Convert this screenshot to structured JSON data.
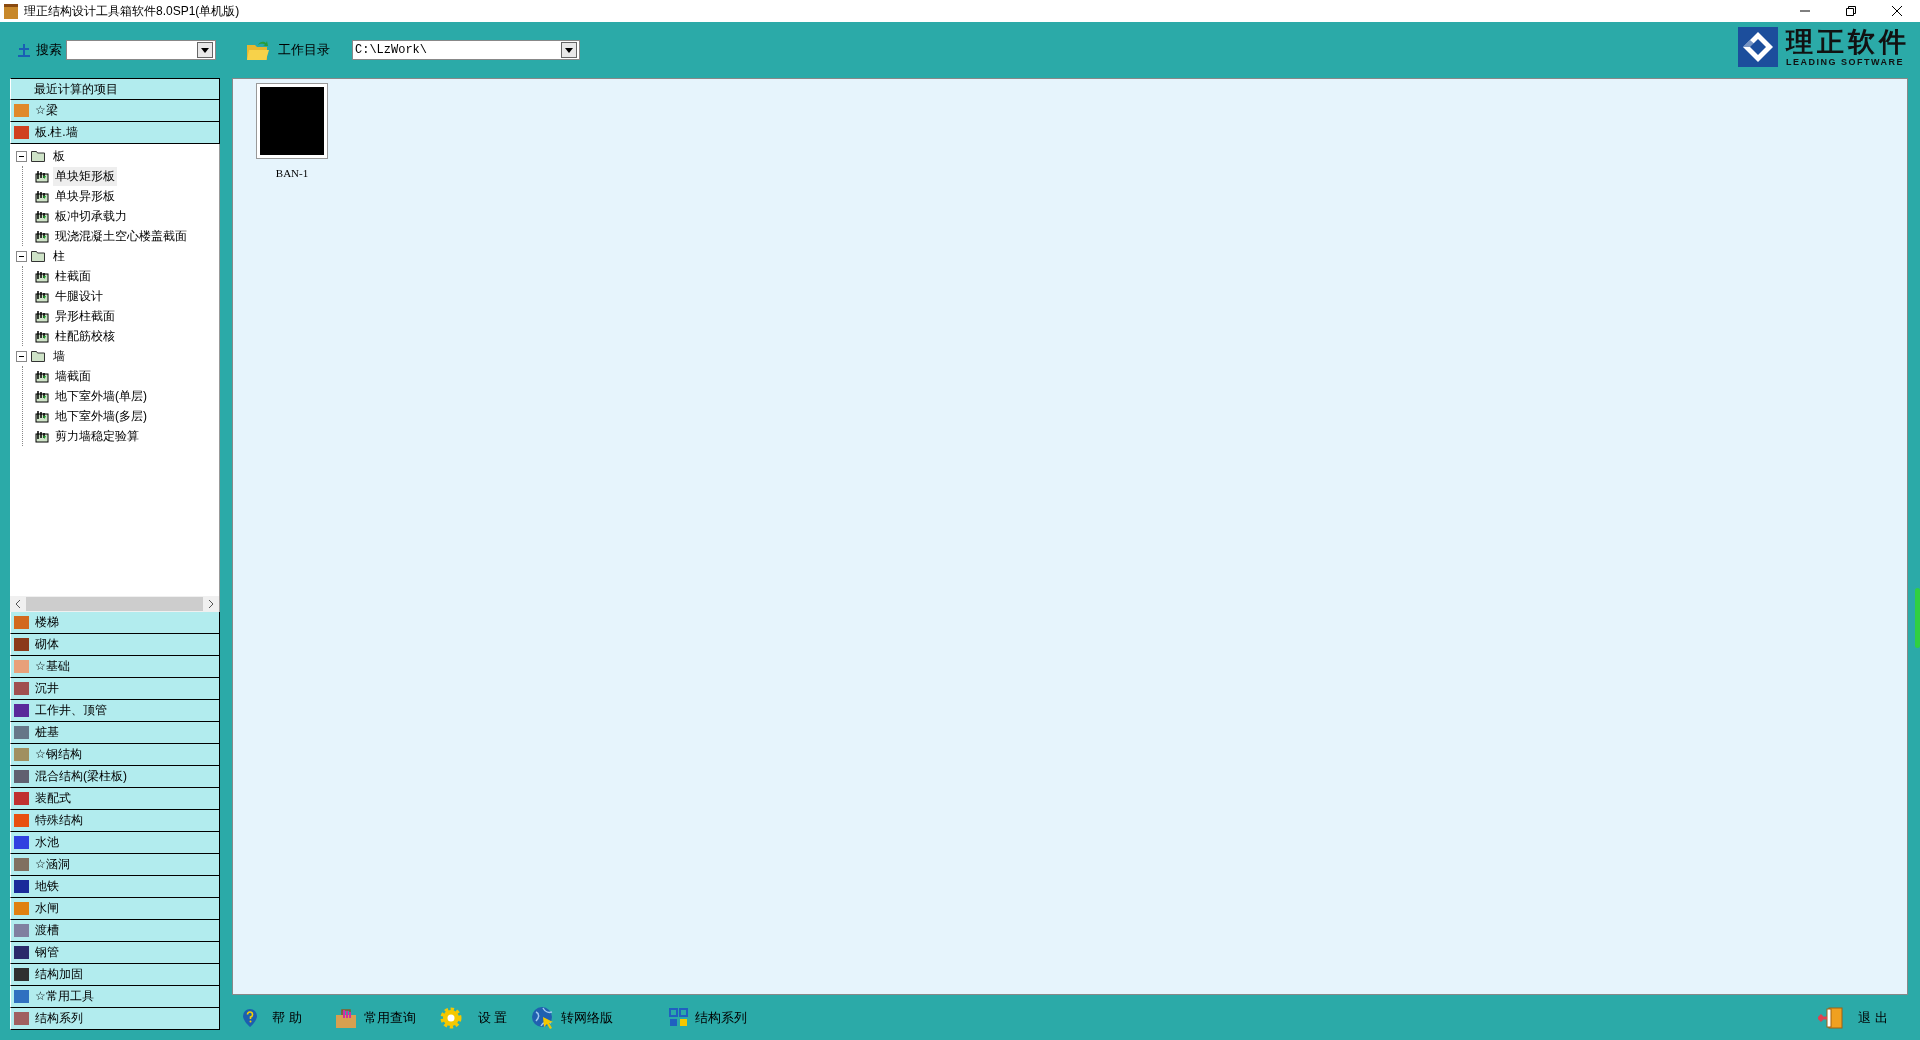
{
  "window": {
    "title": "理正结构设计工具箱软件8.0SP1(单机版)"
  },
  "toolbar": {
    "search_label": "搜索",
    "workdir_label": "工作目录",
    "workdir_value": "C:\\LzWork\\"
  },
  "logo": {
    "name": "理正软件",
    "tagline": "LEADING SOFTWARE"
  },
  "sidebar": {
    "headers": [
      {
        "label": "最近计算的项目",
        "icon": false
      },
      {
        "label": "☆梁",
        "icon": true
      },
      {
        "label": "板.柱.墙",
        "icon": true
      }
    ],
    "tree": [
      {
        "label": "板",
        "expanded": true,
        "children": [
          {
            "label": "单块矩形板",
            "selected": true
          },
          {
            "label": "单块异形板",
            "selected": false
          },
          {
            "label": "板冲切承载力",
            "selected": false
          },
          {
            "label": "现浇混凝土空心楼盖截面",
            "selected": false
          }
        ]
      },
      {
        "label": "柱",
        "expanded": true,
        "children": [
          {
            "label": "柱截面",
            "selected": false
          },
          {
            "label": "牛腿设计",
            "selected": false
          },
          {
            "label": "异形柱截面",
            "selected": false
          },
          {
            "label": "柱配筋校核",
            "selected": false
          }
        ]
      },
      {
        "label": "墙",
        "expanded": true,
        "children": [
          {
            "label": "墙截面",
            "selected": false
          },
          {
            "label": "地下室外墙(单层)",
            "selected": false
          },
          {
            "label": "地下室外墙(多层)",
            "selected": false
          },
          {
            "label": "剪力墙稳定验算",
            "selected": false
          }
        ]
      }
    ],
    "categories": [
      {
        "label": "楼梯"
      },
      {
        "label": "砌体"
      },
      {
        "label": "☆基础"
      },
      {
        "label": "沉井"
      },
      {
        "label": "工作井、顶管"
      },
      {
        "label": "桩基"
      },
      {
        "label": "☆钢结构"
      },
      {
        "label": "混合结构(梁柱板)"
      },
      {
        "label": "装配式"
      },
      {
        "label": "特殊结构"
      },
      {
        "label": "水池"
      },
      {
        "label": "☆涵洞"
      },
      {
        "label": "地铁"
      },
      {
        "label": "水闸"
      },
      {
        "label": "渡槽"
      },
      {
        "label": "钢管"
      },
      {
        "label": "结构加固"
      },
      {
        "label": "☆常用工具"
      },
      {
        "label": "结构系列"
      }
    ]
  },
  "files": [
    {
      "name": "BAN-1"
    }
  ],
  "bottom_bar": {
    "left": [
      {
        "label": "帮 助"
      },
      {
        "label": "常用查询"
      },
      {
        "label": "设 置"
      },
      {
        "label": "转网络版"
      },
      {
        "label": "结构系列"
      }
    ],
    "right": [
      {
        "label": "退 出"
      }
    ]
  }
}
